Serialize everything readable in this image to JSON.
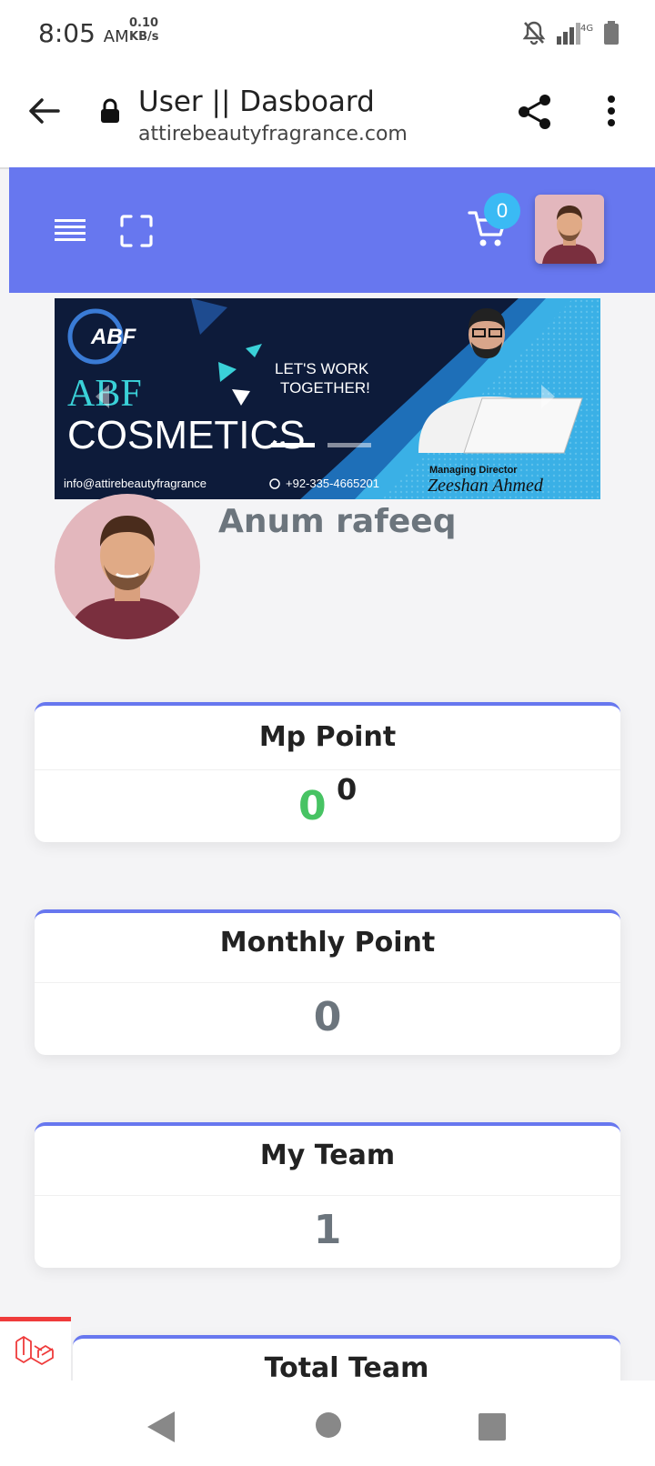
{
  "status_bar": {
    "time": "8:05",
    "ampm": "AM",
    "net_speed": "0.10",
    "net_unit": "KB/s",
    "network_type": "4G",
    "icons": [
      "bell-off-icon",
      "signal-icon",
      "battery-icon"
    ]
  },
  "browser": {
    "page_title": "User || Dasboard",
    "domain": "attirebeautyfragrance.com",
    "icons": [
      "back-arrow-icon",
      "lock-icon",
      "share-icon",
      "more-vert-icon"
    ]
  },
  "app_bar": {
    "color": "#6777ef",
    "cart_count": "0",
    "icons": [
      "menu-icon",
      "fullscreen-icon",
      "cart-icon"
    ]
  },
  "banner": {
    "logo_text": "ABF",
    "brand_line1": "ABF",
    "brand_line2": "COSMETICS",
    "tagline_1": "LET'S WORK",
    "tagline_2": "TOGETHER!",
    "email": "info@attirebeautyfragrance",
    "phone": "+92-335-4665201",
    "role": "Managing Director",
    "person": "Zeeshan Ahmed"
  },
  "profile": {
    "name": "Anum rafeeq"
  },
  "cards": [
    {
      "title": "Mp Point",
      "value": "0",
      "superscript": "0"
    },
    {
      "title": "Monthly Point",
      "value": "0"
    },
    {
      "title": "My Team",
      "value": "1"
    },
    {
      "title": "Total Team"
    }
  ],
  "colors": {
    "accent": "#6777ef",
    "badge": "#3abaf4",
    "green": "#47c363",
    "muted": "#6c757d"
  }
}
